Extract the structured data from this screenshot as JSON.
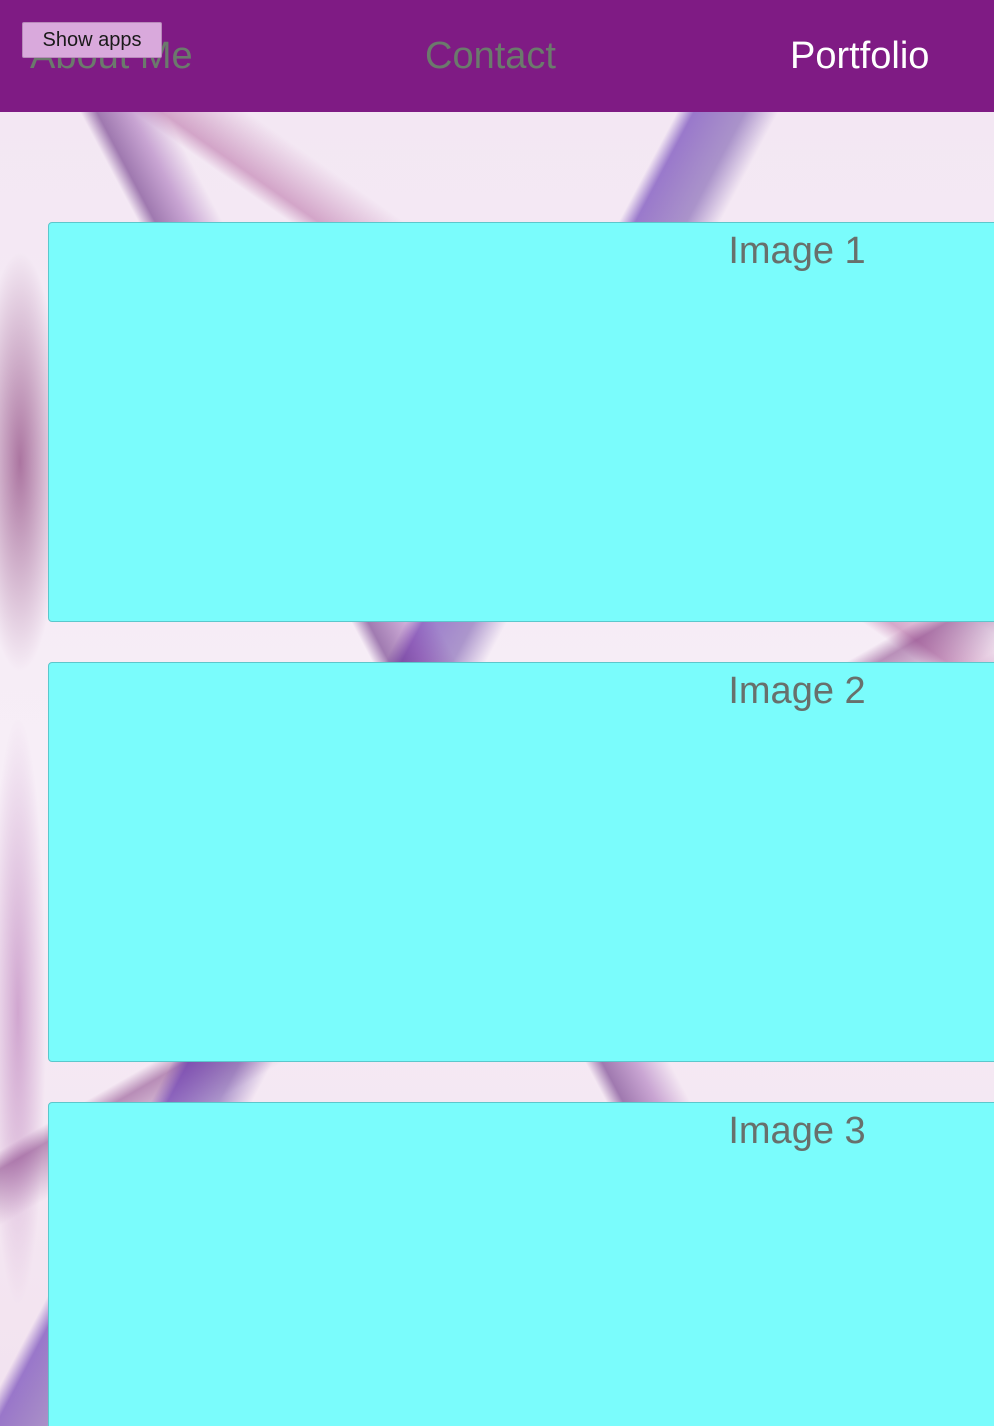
{
  "app": {
    "show_apps_label": "Show apps"
  },
  "nav": {
    "items": [
      {
        "label": "About Me"
      },
      {
        "label": "Contact"
      },
      {
        "label": "Portfolio"
      }
    ],
    "active": "Portfolio"
  },
  "portfolio": {
    "cards": [
      {
        "title": "Image 1"
      },
      {
        "title": "Image 2"
      },
      {
        "title": "Image 3"
      }
    ]
  },
  "colors": {
    "topbar": "#7f1b84",
    "card": "#7afcfc",
    "nav_inactive": "#6b7a6c",
    "nav_active": "#ffffff"
  }
}
